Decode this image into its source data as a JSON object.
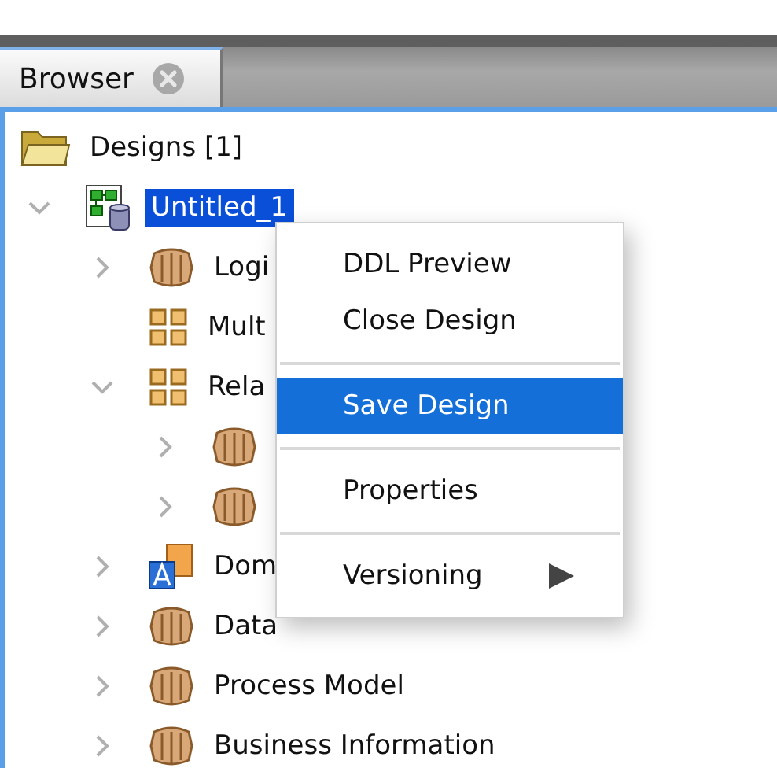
{
  "tab": {
    "label": "Browser",
    "closable": true
  },
  "tree": [
    {
      "label": "Designs [1]",
      "kind": "folder",
      "children": [
        {
          "label": "Untitled_1",
          "kind": "design",
          "expanded": true,
          "selected": true,
          "children": [
            {
              "label": "Logi",
              "kind": "cube",
              "expanded": false,
              "selected": false
            },
            {
              "label": "Mult",
              "kind": "grid",
              "selected": false
            },
            {
              "label": "Rela",
              "kind": "grid",
              "expanded": true,
              "selected": false,
              "children": [
                {
                  "kind": "cube",
                  "expanded": false
                },
                {
                  "kind": "cube",
                  "expanded": false
                }
              ]
            },
            {
              "label": "Dom",
              "kind": "domain",
              "expanded": false,
              "selected": false
            },
            {
              "label": "Data",
              "kind": "cube",
              "expanded": false,
              "selected": false
            },
            {
              "label": "Process Model",
              "kind": "cube",
              "expanded": false,
              "selected": false
            },
            {
              "label": "Business Information",
              "kind": "cube",
              "expanded": false,
              "selected": false
            }
          ]
        }
      ]
    }
  ],
  "context_menu": [
    {
      "kind": "item",
      "label": "DDL Preview",
      "selected": false
    },
    {
      "kind": "item",
      "label": "Close Design",
      "selected": false
    },
    {
      "kind": "separator"
    },
    {
      "kind": "item",
      "label": "Save Design",
      "selected": true
    },
    {
      "kind": "separator"
    },
    {
      "kind": "item",
      "label": "Properties",
      "selected": false
    },
    {
      "kind": "separator"
    },
    {
      "kind": "item",
      "label": "Versioning",
      "selected": false,
      "submenu": true
    }
  ]
}
